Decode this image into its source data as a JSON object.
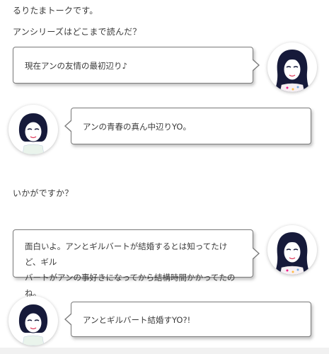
{
  "intro_lines": [
    "るりたまトークです。",
    "アンシリーズはどこまで読んだ？"
  ],
  "question": "いかがですか？",
  "messages": [
    {
      "speaker": "long-hair",
      "text": "現在アンの友情の最初辺り♪"
    },
    {
      "speaker": "short-hair",
      "text": "アンの青春の真ん中辺りYO。"
    },
    {
      "speaker": "long-hair",
      "lines": [
        "面白いよ。アンとギルバートが結婚するとは知ってたけど、ギル",
        "バートがアンの事好きになってから結構時間かかってたのね。"
      ]
    },
    {
      "speaker": "short-hair",
      "text": "アンとギルバート結婚すYO?!"
    }
  ],
  "colors": {
    "bubble_border": "#7a7a7a",
    "text": "#3a3a3a",
    "hair": "#161a3a"
  },
  "icons": [
    "long-hair-girl-avatar",
    "short-hair-girl-avatar"
  ]
}
